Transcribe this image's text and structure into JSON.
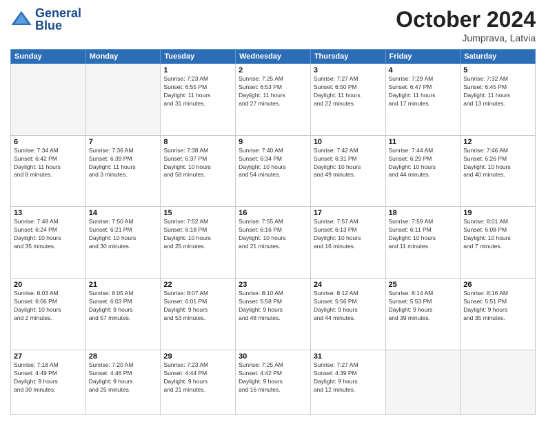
{
  "header": {
    "logo_line1": "General",
    "logo_line2": "Blue",
    "month": "October 2024",
    "location": "Jumprava, Latvia"
  },
  "weekdays": [
    "Sunday",
    "Monday",
    "Tuesday",
    "Wednesday",
    "Thursday",
    "Friday",
    "Saturday"
  ],
  "weeks": [
    [
      {
        "day": "",
        "info": ""
      },
      {
        "day": "",
        "info": ""
      },
      {
        "day": "1",
        "info": "Sunrise: 7:23 AM\nSunset: 6:55 PM\nDaylight: 11 hours\nand 31 minutes."
      },
      {
        "day": "2",
        "info": "Sunrise: 7:25 AM\nSunset: 6:53 PM\nDaylight: 11 hours\nand 27 minutes."
      },
      {
        "day": "3",
        "info": "Sunrise: 7:27 AM\nSunset: 6:50 PM\nDaylight: 11 hours\nand 22 minutes."
      },
      {
        "day": "4",
        "info": "Sunrise: 7:29 AM\nSunset: 6:47 PM\nDaylight: 11 hours\nand 17 minutes."
      },
      {
        "day": "5",
        "info": "Sunrise: 7:32 AM\nSunset: 6:45 PM\nDaylight: 11 hours\nand 13 minutes."
      }
    ],
    [
      {
        "day": "6",
        "info": "Sunrise: 7:34 AM\nSunset: 6:42 PM\nDaylight: 11 hours\nand 8 minutes."
      },
      {
        "day": "7",
        "info": "Sunrise: 7:36 AM\nSunset: 6:39 PM\nDaylight: 11 hours\nand 3 minutes."
      },
      {
        "day": "8",
        "info": "Sunrise: 7:38 AM\nSunset: 6:37 PM\nDaylight: 10 hours\nand 58 minutes."
      },
      {
        "day": "9",
        "info": "Sunrise: 7:40 AM\nSunset: 6:34 PM\nDaylight: 10 hours\nand 54 minutes."
      },
      {
        "day": "10",
        "info": "Sunrise: 7:42 AM\nSunset: 6:31 PM\nDaylight: 10 hours\nand 49 minutes."
      },
      {
        "day": "11",
        "info": "Sunrise: 7:44 AM\nSunset: 6:29 PM\nDaylight: 10 hours\nand 44 minutes."
      },
      {
        "day": "12",
        "info": "Sunrise: 7:46 AM\nSunset: 6:26 PM\nDaylight: 10 hours\nand 40 minutes."
      }
    ],
    [
      {
        "day": "13",
        "info": "Sunrise: 7:48 AM\nSunset: 6:24 PM\nDaylight: 10 hours\nand 35 minutes."
      },
      {
        "day": "14",
        "info": "Sunrise: 7:50 AM\nSunset: 6:21 PM\nDaylight: 10 hours\nand 30 minutes."
      },
      {
        "day": "15",
        "info": "Sunrise: 7:52 AM\nSunset: 6:18 PM\nDaylight: 10 hours\nand 25 minutes."
      },
      {
        "day": "16",
        "info": "Sunrise: 7:55 AM\nSunset: 6:16 PM\nDaylight: 10 hours\nand 21 minutes."
      },
      {
        "day": "17",
        "info": "Sunrise: 7:57 AM\nSunset: 6:13 PM\nDaylight: 10 hours\nand 16 minutes."
      },
      {
        "day": "18",
        "info": "Sunrise: 7:59 AM\nSunset: 6:11 PM\nDaylight: 10 hours\nand 11 minutes."
      },
      {
        "day": "19",
        "info": "Sunrise: 8:01 AM\nSunset: 6:08 PM\nDaylight: 10 hours\nand 7 minutes."
      }
    ],
    [
      {
        "day": "20",
        "info": "Sunrise: 8:03 AM\nSunset: 6:06 PM\nDaylight: 10 hours\nand 2 minutes."
      },
      {
        "day": "21",
        "info": "Sunrise: 8:05 AM\nSunset: 6:03 PM\nDaylight: 9 hours\nand 57 minutes."
      },
      {
        "day": "22",
        "info": "Sunrise: 8:07 AM\nSunset: 6:01 PM\nDaylight: 9 hours\nand 53 minutes."
      },
      {
        "day": "23",
        "info": "Sunrise: 8:10 AM\nSunset: 5:58 PM\nDaylight: 9 hours\nand 48 minutes."
      },
      {
        "day": "24",
        "info": "Sunrise: 8:12 AM\nSunset: 5:56 PM\nDaylight: 9 hours\nand 44 minutes."
      },
      {
        "day": "25",
        "info": "Sunrise: 8:14 AM\nSunset: 5:53 PM\nDaylight: 9 hours\nand 39 minutes."
      },
      {
        "day": "26",
        "info": "Sunrise: 8:16 AM\nSunset: 5:51 PM\nDaylight: 9 hours\nand 35 minutes."
      }
    ],
    [
      {
        "day": "27",
        "info": "Sunrise: 7:18 AM\nSunset: 4:49 PM\nDaylight: 9 hours\nand 30 minutes."
      },
      {
        "day": "28",
        "info": "Sunrise: 7:20 AM\nSunset: 4:46 PM\nDaylight: 9 hours\nand 25 minutes."
      },
      {
        "day": "29",
        "info": "Sunrise: 7:23 AM\nSunset: 4:44 PM\nDaylight: 9 hours\nand 21 minutes."
      },
      {
        "day": "30",
        "info": "Sunrise: 7:25 AM\nSunset: 4:42 PM\nDaylight: 9 hours\nand 16 minutes."
      },
      {
        "day": "31",
        "info": "Sunrise: 7:27 AM\nSunset: 4:39 PM\nDaylight: 9 hours\nand 12 minutes."
      },
      {
        "day": "",
        "info": ""
      },
      {
        "day": "",
        "info": ""
      }
    ]
  ]
}
